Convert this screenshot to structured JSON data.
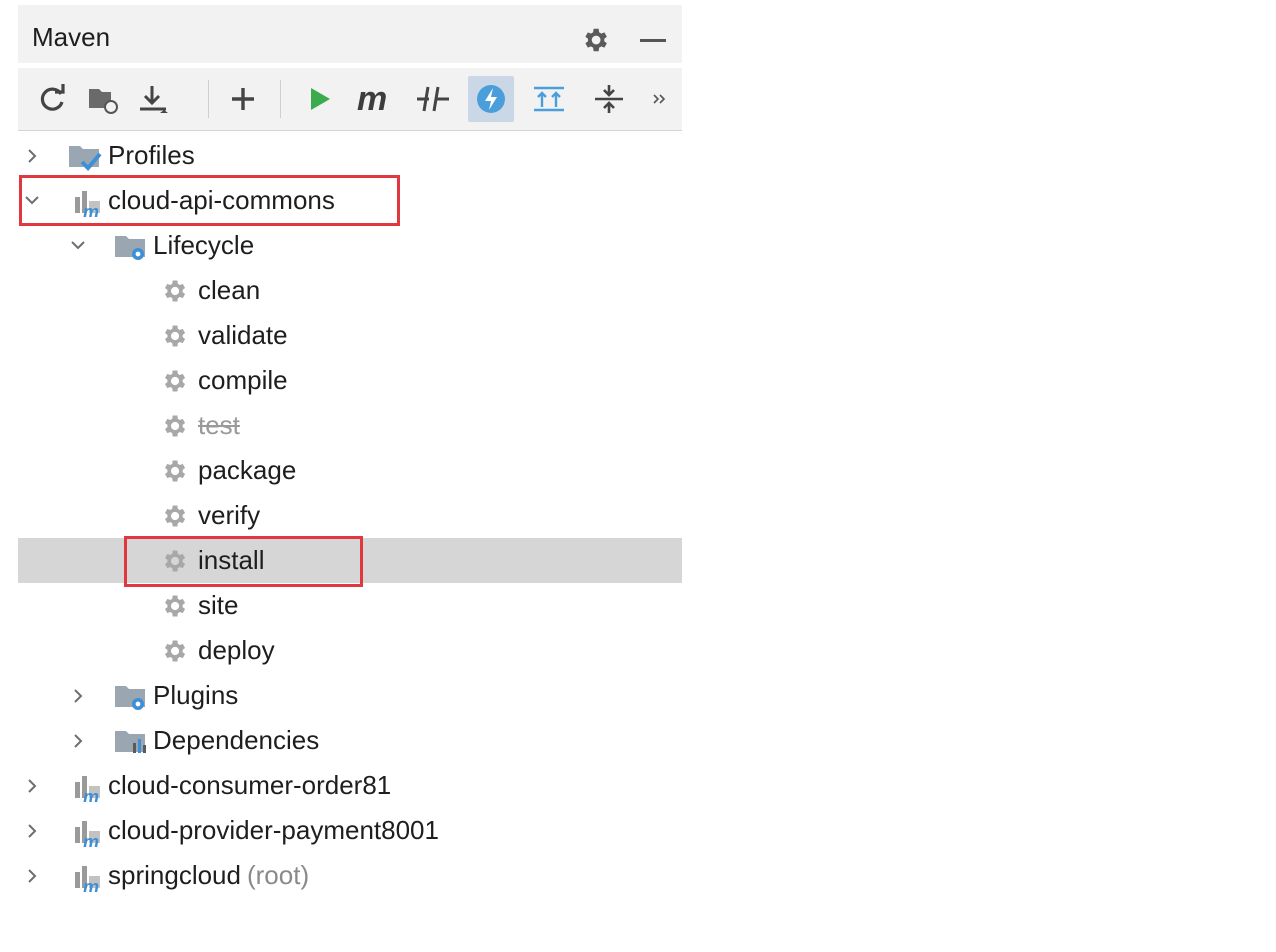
{
  "header": {
    "title": "Maven"
  },
  "toolbar": {
    "buttons": [
      {
        "name": "reload-icon",
        "tooltip": "Reload All Maven Projects"
      },
      {
        "name": "generate-sources-icon",
        "tooltip": "Generate Sources"
      },
      {
        "name": "download-icon",
        "tooltip": "Download Sources"
      },
      {
        "name": "add-icon",
        "tooltip": "Add Maven Projects"
      },
      {
        "name": "run-icon",
        "tooltip": "Run Maven Build"
      },
      {
        "name": "execute-goal-icon",
        "tooltip": "Execute Maven Goal"
      },
      {
        "name": "toggle-offline-icon",
        "tooltip": "Toggle Offline Mode"
      },
      {
        "name": "skip-tests-icon",
        "tooltip": "Toggle Skip Tests Mode",
        "active": true
      },
      {
        "name": "show-dependencies-icon",
        "tooltip": "Show Dependencies"
      },
      {
        "name": "collapse-all-icon",
        "tooltip": "Collapse All"
      },
      {
        "name": "more-icon",
        "tooltip": "More"
      }
    ]
  },
  "tree": {
    "profiles": "Profiles",
    "project1": "cloud-api-commons",
    "lifecycle": "Lifecycle",
    "goals": [
      "clean",
      "validate",
      "compile",
      "test",
      "package",
      "verify",
      "install",
      "site",
      "deploy"
    ],
    "plugins": "Plugins",
    "dependencies": "Dependencies",
    "project2": "cloud-consumer-order81",
    "project3": "cloud-provider-payment8001",
    "project4": "springcloud",
    "project4_suffix": "(root)"
  },
  "colors": {
    "highlight_box": "#e0383e",
    "selected_row": "#d6d6d6",
    "skip_tests_active": "#4a9fdb"
  }
}
